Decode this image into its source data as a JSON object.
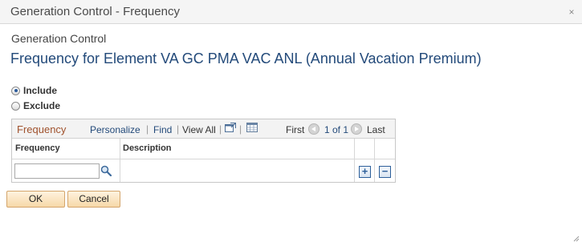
{
  "window": {
    "title": "Generation Control - Frequency",
    "close_symbol": "×"
  },
  "page": {
    "subtitle": "Generation Control",
    "heading": "Frequency for Element VA GC PMA VAC ANL (Annual Vacation Premium)"
  },
  "options": [
    {
      "label": "Include",
      "checked": true
    },
    {
      "label": "Exclude",
      "checked": false
    }
  ],
  "grid": {
    "title": "Frequency",
    "personalize": "Personalize",
    "separator": "|",
    "find": "Find",
    "view_all": "View All",
    "first": "First",
    "range": "1 of 1",
    "last": "Last",
    "columns": [
      "Frequency",
      "Description"
    ],
    "rows": [
      {
        "frequency": "",
        "description": ""
      }
    ],
    "add_symbol": "+",
    "delete_symbol": "−"
  },
  "buttons": {
    "ok": "OK",
    "cancel": "Cancel"
  },
  "icons": {
    "lookup": "magnifier-icon",
    "zoom": "new-window-icon",
    "download": "download-to-excel-icon",
    "resize": "resize-grip-icon"
  },
  "colors": {
    "heading": "#234a7a",
    "link": "#234a7a",
    "grid_title": "#a0522d",
    "button_fill": "#f6d8a8"
  }
}
